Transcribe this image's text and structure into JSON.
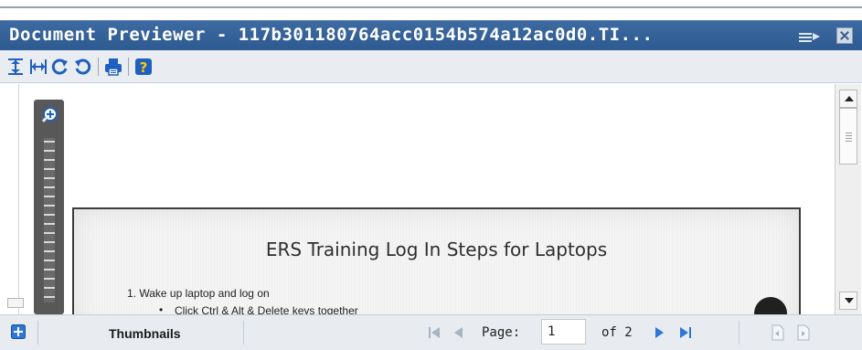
{
  "window": {
    "title": "Document Previewer - 117b301180764acc0154b574a12ac0d0.TI..."
  },
  "toolbar": {
    "buttons": [
      {
        "name": "fit-height",
        "icon": "fit-height-icon"
      },
      {
        "name": "fit-width",
        "icon": "fit-width-icon"
      },
      {
        "name": "rotate-clockwise",
        "icon": "rotate-clockwise-icon"
      },
      {
        "name": "rotate-counterclockwise",
        "icon": "rotate-counterclockwise-icon"
      },
      {
        "name": "print",
        "icon": "print-icon"
      },
      {
        "name": "help",
        "icon": "help-icon",
        "label": "?"
      }
    ]
  },
  "document": {
    "heading": "ERS Training Log In Steps for Laptops",
    "step1": "1.   Wake up laptop and log on",
    "bullet1": "Click Ctrl & Alt & Delete keys together"
  },
  "statusbar": {
    "thumbnails_label": "Thumbnails",
    "page_label": "Page:",
    "page_value": "1",
    "of_label": "of 2"
  },
  "colors": {
    "titlebar": "#3265a0",
    "accent_blue": "#2f77d6",
    "zoom_panel": "#585858"
  }
}
